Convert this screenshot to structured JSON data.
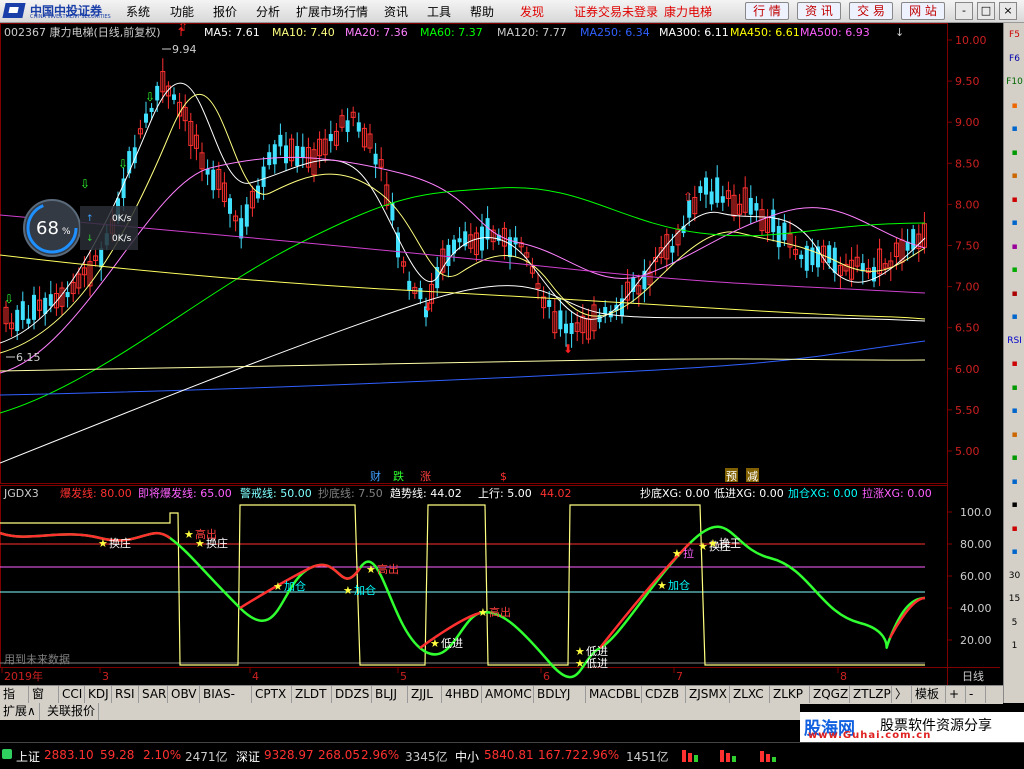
{
  "menubar": {
    "logo_cn": "中国中投证券",
    "logo_en": "CHINA INVESTMENT SECURITIES",
    "items": [
      "系统",
      "功能",
      "报价",
      "分析",
      "扩展市场行情",
      "资讯",
      "工具",
      "帮助"
    ],
    "special": "发现",
    "notice": "证券交易未登录",
    "stock_name": "康力电梯",
    "buttons": [
      "行 情",
      "资 讯",
      "交 易",
      "网 站"
    ],
    "window_controls": [
      "-",
      "□",
      "×"
    ]
  },
  "main_panel": {
    "title": "002367 康力电梯(日线,前复权)",
    "ma_legend": [
      {
        "label": "MA5: 7.61",
        "color": "#ffffff"
      },
      {
        "label": "MA10: 7.40",
        "color": "#ffff80"
      },
      {
        "label": "MA20: 7.36",
        "color": "#ff80ff"
      },
      {
        "label": "MA60: 7.37",
        "color": "#00ff00"
      },
      {
        "label": "MA120: 7.77",
        "color": "#cccccc"
      },
      {
        "label": "MA250: 6.34",
        "color": "#3060ff"
      },
      {
        "label": "MA300: 6.11",
        "color": "#ffffff"
      },
      {
        "label": "MA450: 6.61",
        "color": "#ffff00"
      },
      {
        "label": "MA500: 6.93",
        "color": "#ff60ff"
      }
    ],
    "y_ticks": [
      "10.00",
      "9.50",
      "9.00",
      "8.50",
      "8.00",
      "7.50",
      "7.00",
      "6.50",
      "6.00",
      "5.50",
      "5.00"
    ],
    "high_label": "9.94",
    "low_label": "6.15",
    "gauge": {
      "value": "68",
      "unit": "%",
      "up": "0K/s",
      "down": "0K/s"
    },
    "markers": [
      "财",
      "跌",
      "涨",
      "$",
      "预",
      "减"
    ]
  },
  "indicator_panel": {
    "legend": [
      {
        "label": "JGDX3",
        "color": "#cccccc"
      },
      {
        "label": "爆发线: 80.00",
        "color": "#ff3030"
      },
      {
        "label": "即将爆发线: 65.00",
        "color": "#ff60ff"
      },
      {
        "label": "警戒线: 50.00",
        "color": "#80ffff"
      },
      {
        "label": "抄底线: 7.50",
        "color": "#808080"
      },
      {
        "label": "趋势线: 44.02",
        "color": "#ffffff"
      },
      {
        "label": "上行: 5.00",
        "color": "#ffffff"
      },
      {
        "label": "44.02",
        "color": "#ff3030"
      },
      {
        "label": "抄底XG: 0.00",
        "color": "#ffffff"
      },
      {
        "label": "低进XG: 0.00",
        "color": "#ffffff"
      },
      {
        "label": "加仓XG: 0.00",
        "color": "#00ffff"
      },
      {
        "label": "拉涨XG: 0.00",
        "color": "#ff60ff"
      }
    ],
    "y_ticks": [
      "100.0",
      "80.00",
      "60.00",
      "40.00",
      "20.00"
    ],
    "signals": [
      "换庄",
      "换庄",
      "高出",
      "高出",
      "加仓",
      "加仓",
      "低进",
      "高出",
      "低进",
      "低进",
      "加仓",
      "拉",
      "换庄",
      "换王"
    ],
    "watermark": "用到未来数据"
  },
  "x_axis": {
    "labels": [
      "2019年",
      "3",
      "4",
      "5",
      "6",
      "7",
      "8"
    ],
    "corner": "日线"
  },
  "tabs": [
    "指标",
    "窗口",
    "CCI",
    "KDJ",
    "RSI",
    "SAR",
    "OBV",
    "BIAS-QL",
    "CPTX",
    "ZLDT",
    "DDZS",
    "BLJJ",
    "ZJJL",
    "4HBD",
    "AMOMC",
    "BDLYJ",
    "MACDBL",
    "CDZB",
    "ZJSMX",
    "ZLXC",
    "ZLKP",
    "ZQGZ",
    "ZTLZP",
    "〉",
    "模板",
    "+",
    "-"
  ],
  "tabs2": [
    "扩展∧",
    "关联报价"
  ],
  "right_toolbar": [
    "F5",
    "F6",
    "F10",
    "",
    "",
    "",
    "",
    "",
    "",
    "",
    "",
    "",
    "",
    "RSI",
    "",
    "",
    "",
    "",
    "",
    "",
    "",
    "",
    "",
    "30",
    "15",
    "5",
    "1"
  ],
  "status": [
    {
      "name": "上证",
      "price": "2883.10",
      "chg": "59.28",
      "pct": "2.10%",
      "amt": "2471亿"
    },
    {
      "name": "深证",
      "price": "9328.97",
      "chg": "268.05",
      "pct": "2.96%",
      "amt": "3345亿"
    },
    {
      "name": "中小",
      "price": "5840.81",
      "chg": "167.72",
      "pct": "2.96%",
      "amt": "1451亿"
    }
  ],
  "ad": {
    "line1": "股海网",
    "line2": "股票软件资源分享",
    "url": "www.Guhai.com.cn"
  },
  "colors": {
    "up": "#ff3030",
    "down": "#40e0ff",
    "ma5": "#ffffff",
    "ma10": "#ffff80",
    "ma20": "#ff80ff",
    "ma60": "#00ff00",
    "ma250": "#3060ff",
    "ma450": "#ffff60",
    "ma500": "#d040d0",
    "grid": "#800000"
  }
}
